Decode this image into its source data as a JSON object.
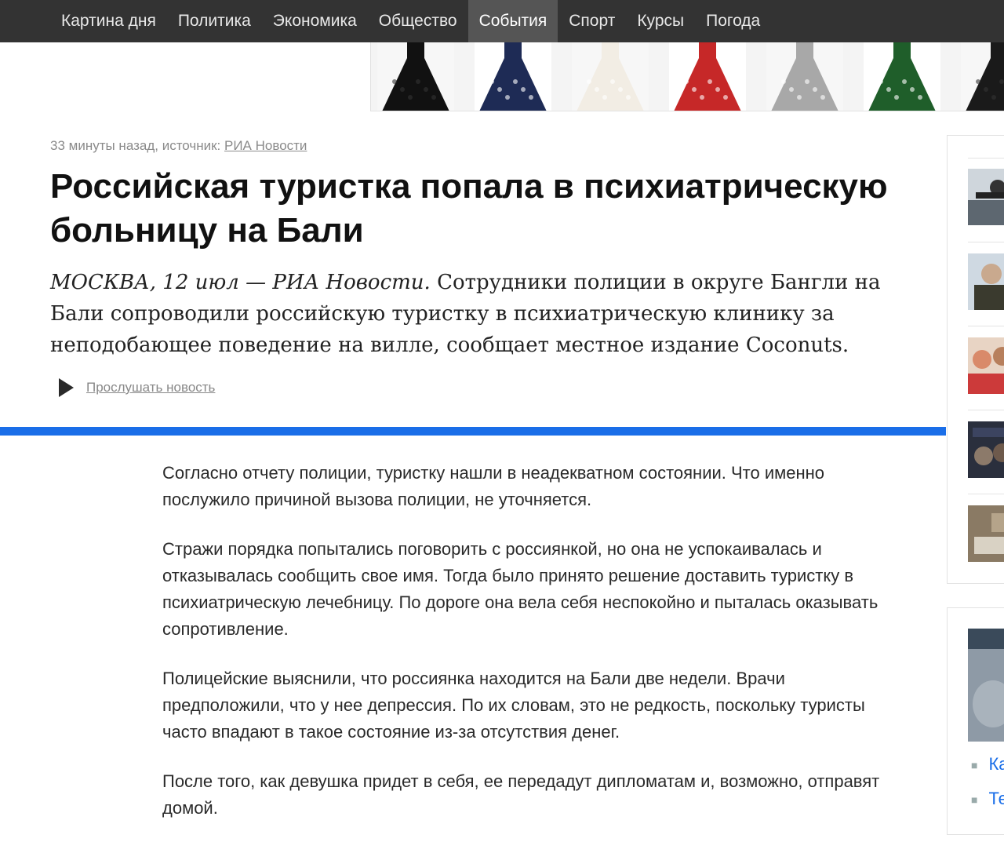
{
  "nav": {
    "items": [
      {
        "label": "Картина дня",
        "active": false
      },
      {
        "label": "Политика",
        "active": false
      },
      {
        "label": "Экономика",
        "active": false
      },
      {
        "label": "Общество",
        "active": false
      },
      {
        "label": "События",
        "active": true
      },
      {
        "label": "Спорт",
        "active": false
      },
      {
        "label": "Курсы",
        "active": false
      },
      {
        "label": "Погода",
        "active": false
      }
    ]
  },
  "ad": {
    "dress_colors": [
      "#111111",
      "#1e2b55",
      "#f2ede4",
      "#c62828",
      "#a8a8a8",
      "#1f5e2a",
      "#1a1a1a"
    ]
  },
  "article": {
    "meta_prefix": "33 минуты назад, источник: ",
    "source_link": "РИА Новости",
    "title": "Российская туристка попала в психиатрическую больницу на Бали",
    "lead_dateline": "МОСКВА, 12 июл — РИА Новости.",
    "lead_text": " Сотрудники полиции в округе Бангли на Бали сопроводили российскую туристку в психиатрическую клинику за неподобающее поведение на вилле, сообщает местное издание Coconuts.",
    "listen_label": "Прослушать новость",
    "paragraphs": [
      "Согласно отчету полиции, туристку нашли в неадекватном состоянии. Что именно послужило причиной вызова полиции, не уточняется.",
      "Стражи порядка попытались поговорить с россиянкой, но она не успокаивалась и отказывалась сообщить свое имя. Тогда было принято решение доставить туристку в психиатрическую лечебницу. По дороге она вела себя неспокойно и пыталась оказывать сопротивление.",
      "Полицейские выяснили, что россиянка находится на Бали две недели. Врачи предположили, что у нее депрессия. По их словам, это не редкость, поскольку туристы часто впадают в такое состояние из-за отсутствия денег.",
      "После того, как девушка придет в себя, ее передадут дипломатам и, возможно, отправят домой."
    ]
  },
  "sidebar": {
    "bullets": [
      "Ка",
      "Те"
    ]
  },
  "colors": {
    "accent": "#1a6ee8",
    "nav_bg": "#333333",
    "nav_active": "#555555"
  }
}
